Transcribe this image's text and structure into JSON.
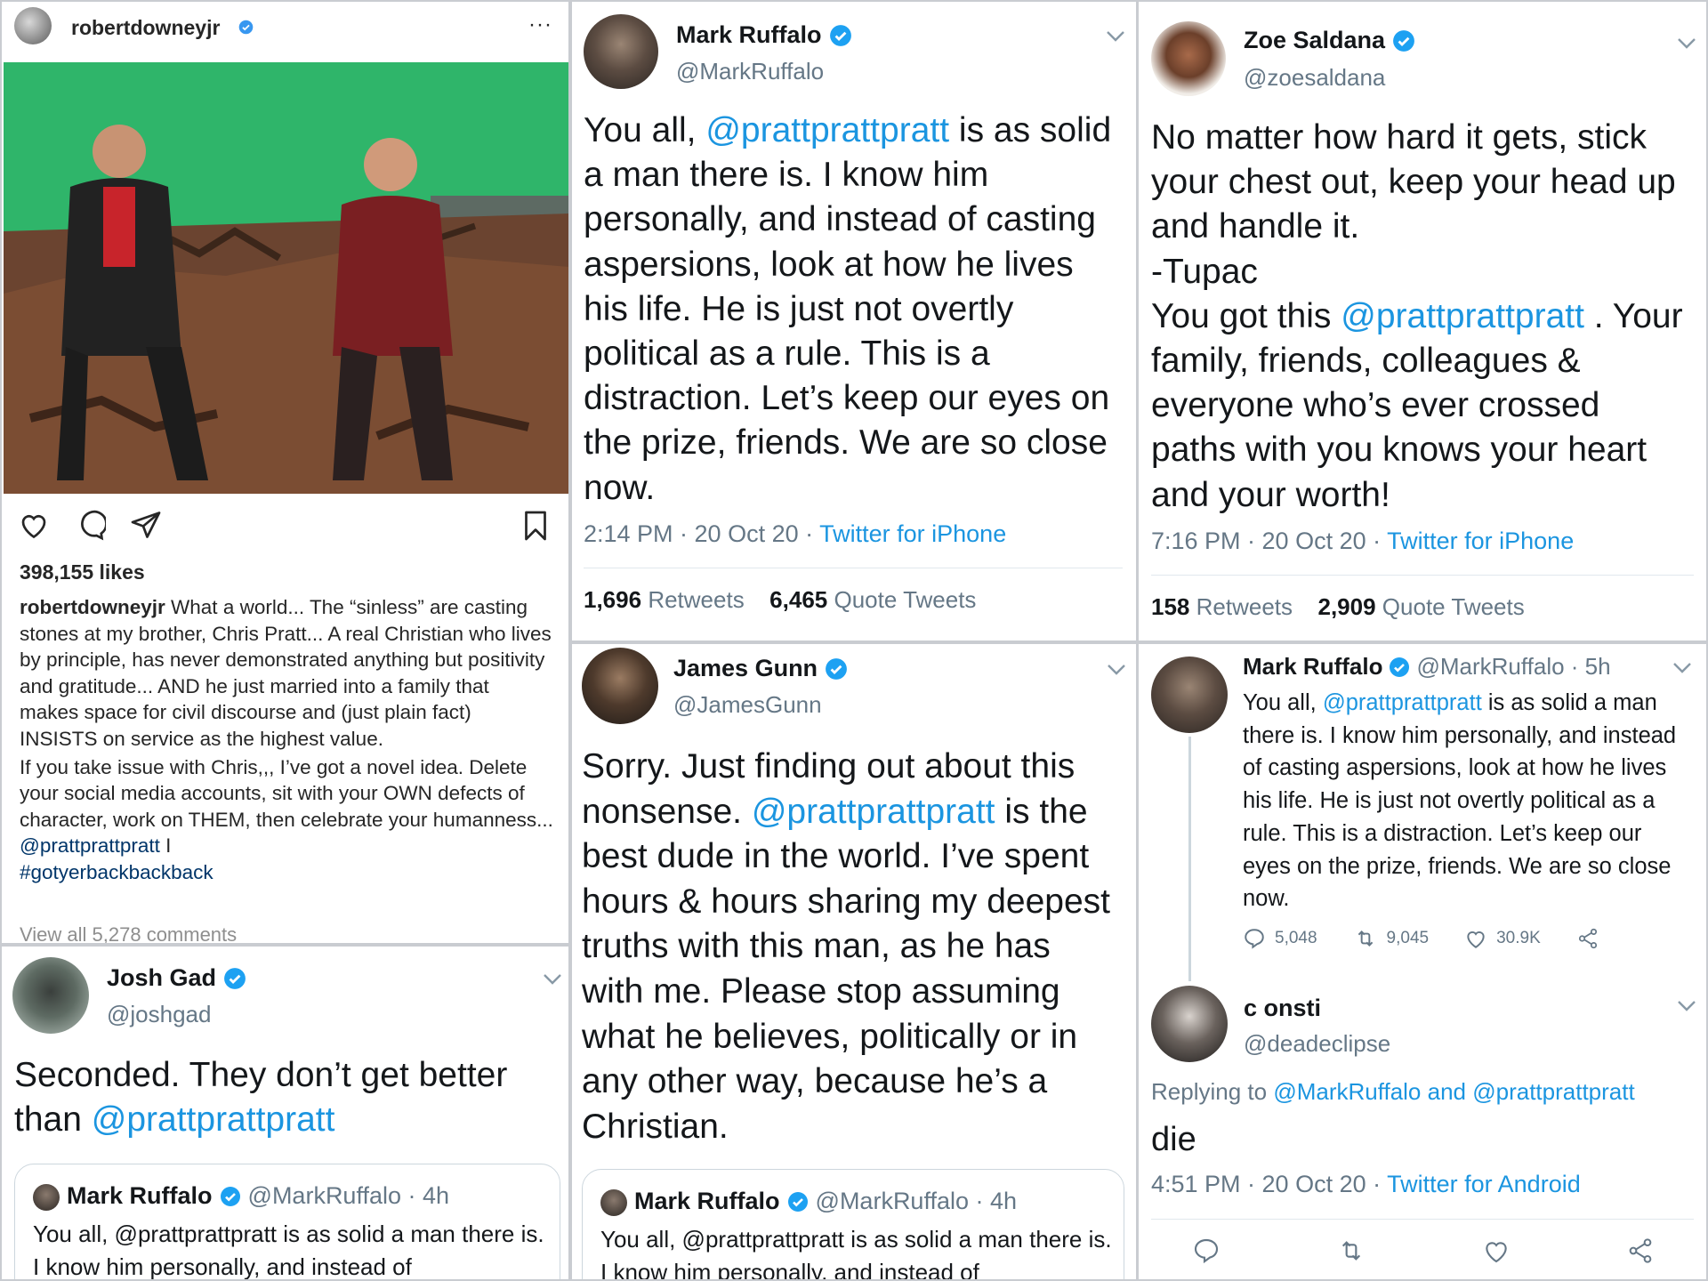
{
  "instagram": {
    "username": "robertdowneyjr",
    "more": "···",
    "likes": "398,155 likes",
    "caption_user": "robertdowneyjr",
    "caption_p1": "What a world... The “sinless” are casting stones at my brother, Chris Pratt... A real Christian who lives by principle, has never demonstrated anything but positivity and gratitude... AND he just married into a family that makes space for civil discourse and (just plain fact) INSISTS on service as the highest value.",
    "caption_p2": "If you take issue with Chris,,, I’ve got a novel idea. Delete your social media accounts, sit with your OWN defects of character, work on THEM, then celebrate your humanness...",
    "caption_mention": "@prattprattpratt",
    "caption_sep": " I",
    "hashtag": "#gotyerbackbackback",
    "view_comments": "View all 5,278 comments"
  },
  "ruffalo_tweet": {
    "name": "Mark Ruffalo",
    "handle": "@MarkRuffalo",
    "text_before": "You all, ",
    "mention": "@prattprattpratt",
    "text_after": " is as solid a man there is. I know him personally, and instead of casting aspersions, look at how he lives his life. He is just not overtly political as a rule. This is a distraction. Let’s keep our eyes on the prize, friends. We are so close now.",
    "meta": "2:14 PM · 20 Oct 20 · ",
    "source": "Twitter for iPhone",
    "retweets": "1,696",
    "retweets_label": "Retweets",
    "quotes": "6,465",
    "quotes_label": "Quote Tweets"
  },
  "saldana_tweet": {
    "name": "Zoe Saldana",
    "handle": "@zoesaldana",
    "line1": "No matter how hard it gets, stick your chest out, keep your head up and handle it.",
    "line2": "-Tupac",
    "text_before": "You got this ",
    "mention": "@prattprattpratt",
    "text_after": " . Your family, friends, colleagues & everyone who’s ever crossed paths with you knows your heart and your worth!",
    "meta": "7:16 PM · 20 Oct 20 · ",
    "source": "Twitter for iPhone",
    "retweets": "158",
    "retweets_label": "Retweets",
    "quotes": "2,909",
    "quotes_label": "Quote Tweets"
  },
  "gad_tweet": {
    "name": "Josh Gad",
    "handle": "@joshgad",
    "text_before": "Seconded. They don’t get better than ",
    "mention": "@prattprattpratt",
    "quote_name": "Mark Ruffalo",
    "quote_handle": "@MarkRuffalo · 4h",
    "quote_text": "You all, @prattprattpratt is as solid a man there is. I know him personally, and instead of"
  },
  "gunn_tweet": {
    "name": "James Gunn",
    "handle": "@JamesGunn",
    "text_before": "Sorry. Just finding out about this nonsense. ",
    "mention": "@prattprattpratt",
    "text_after": " is the best dude in the world. I’ve spent hours & hours sharing my deepest truths with this man, as he has with me. Please stop assuming what he believes, politically or in any other way, because he’s a Christian.",
    "quote_name": "Mark Ruffalo",
    "quote_handle": "@MarkRuffalo · 4h",
    "quote_text": "You all, @prattprattpratt is as solid a man there is. I know him personally, and instead of"
  },
  "thread": {
    "name": "Mark Ruffalo",
    "handle": "@MarkRuffalo · 5h",
    "text_before": "You all, ",
    "mention": "@prattprattpratt",
    "text_after": " is as solid a man there is. I know him personally, and instead of casting aspersions, look at how he lives his life. He is just not overtly political as a rule. This is a distraction. Let’s keep our eyes on the prize, friends. We are so close now.",
    "replies": "5,048",
    "retweets": "9,045",
    "likes": "30.9K",
    "reply_name": "c onsti",
    "reply_handle": "@deadeclipse",
    "replying_to_label": "Replying to ",
    "replying_to_1": "@MarkRuffalo",
    "replying_and": " and ",
    "replying_to_2": "@prattprattpratt",
    "reply_text": "die",
    "reply_meta": "4:51 PM · 20 Oct 20 · ",
    "reply_source": "Twitter for Android"
  },
  "colors": {
    "link": "#1b95e0",
    "verified": "#1da1f2",
    "greenscreen": "#2fb56a"
  }
}
